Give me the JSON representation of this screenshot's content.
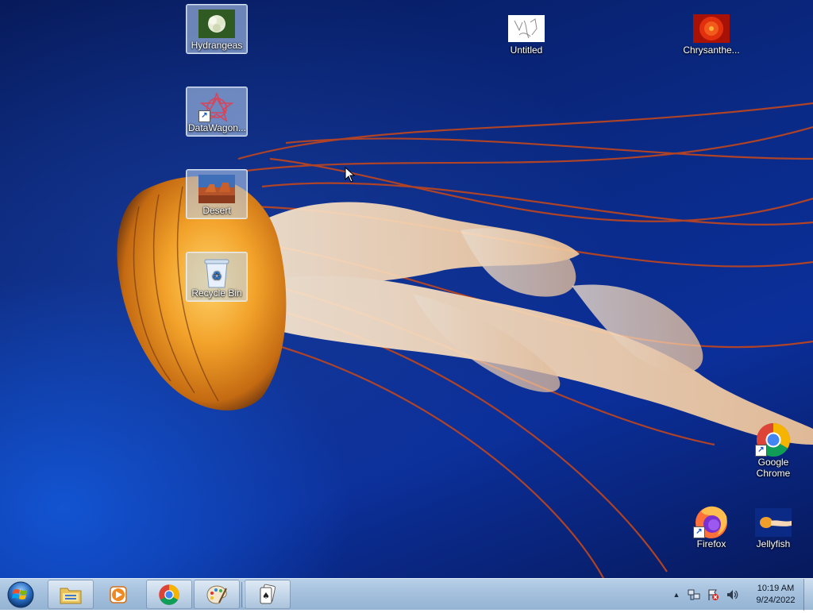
{
  "desktop": {
    "icons": [
      {
        "label": "Hydrangeas",
        "icon": "hydrangeas-image-icon",
        "selected": true
      },
      {
        "label": "DataWagon...",
        "icon": "datawagon-shortcut-icon",
        "selected": true,
        "shortcut": true
      },
      {
        "label": "Desert",
        "icon": "desert-image-icon",
        "selected": true
      },
      {
        "label": "Recycle Bin",
        "icon": "recycle-bin-icon",
        "selected": true
      },
      {
        "label": "Untitled",
        "icon": "untitled-image-icon",
        "selected": false
      },
      {
        "label": "Chrysanthe...",
        "icon": "chrysanthemum-image-icon",
        "selected": false
      },
      {
        "label": "Google Chrome",
        "label_line1": "Google",
        "label_line2": "Chrome",
        "icon": "chrome-shortcut-icon",
        "selected": false,
        "shortcut": true
      },
      {
        "label": "Firefox",
        "icon": "firefox-shortcut-icon",
        "selected": false,
        "shortcut": true
      },
      {
        "label": "Jellyfish",
        "icon": "jellyfish-image-icon",
        "selected": false
      }
    ]
  },
  "taskbar": {
    "start_icon": "windows-start-orb-icon",
    "pinned": [
      {
        "name": "windows-explorer",
        "icon": "folder-icon"
      },
      {
        "name": "media-player",
        "icon": "media-player-icon"
      },
      {
        "name": "google-chrome",
        "icon": "chrome-icon"
      },
      {
        "name": "paint",
        "icon": "paint-palette-icon"
      },
      {
        "name": "solitaire",
        "icon": "solitaire-cards-icon"
      }
    ],
    "tray": {
      "icons": [
        "show-hidden-icons-icon",
        "network-icon",
        "action-center-flag-icon",
        "volume-icon"
      ],
      "time": "10:19 AM",
      "date": "9/24/2022"
    }
  },
  "colors": {
    "wallpaper_blue": "#0a2a86",
    "taskbar": "#a4c0dd",
    "jellyfish_orange": "#e08a1c"
  }
}
